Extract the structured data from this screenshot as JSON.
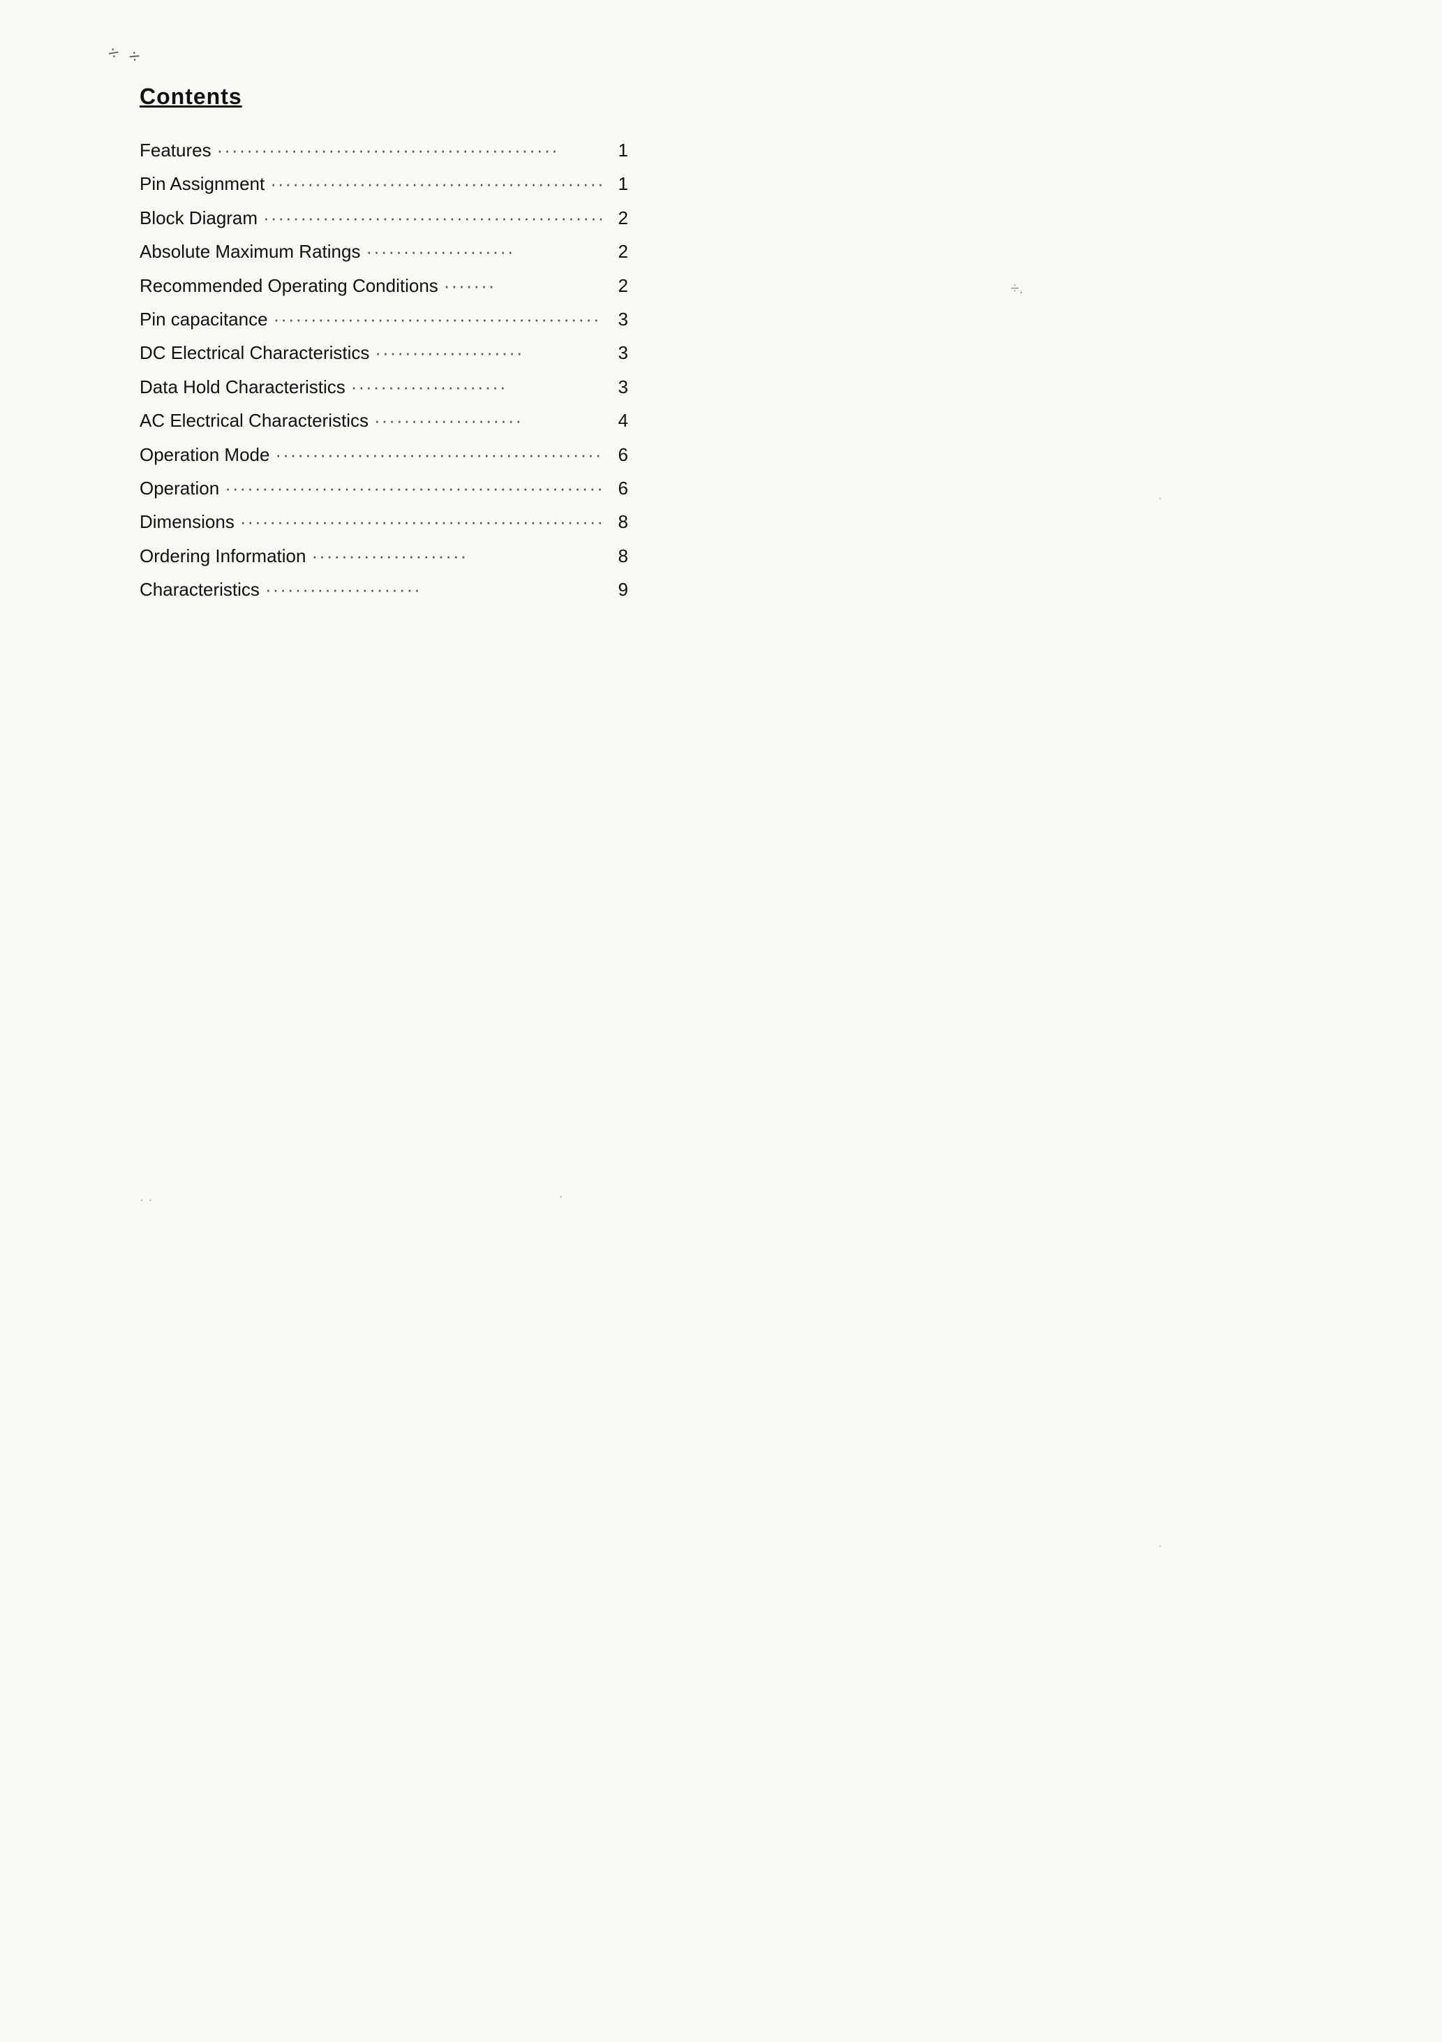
{
  "page": {
    "title": "Contents",
    "toc": {
      "items": [
        {
          "label": "Features",
          "dots": "·······························································",
          "page": "1"
        },
        {
          "label": "Pin Assignment",
          "dots": "·······························································",
          "page": "1"
        },
        {
          "label": "Block Diagram",
          "dots": "·······························································",
          "page": "2"
        },
        {
          "label": "Absolute Maximum Ratings",
          "dots": "·················",
          "page": "2"
        },
        {
          "label": "Recommended Operating Conditions",
          "dots": "········",
          "page": "2"
        },
        {
          "label": "Pin capacitance",
          "dots": "·······························································",
          "page": "3"
        },
        {
          "label": "DC Electrical Characteristics",
          "dots": "···················",
          "page": "3"
        },
        {
          "label": "Data Hold Characteristics",
          "dots": "·····················",
          "page": "3"
        },
        {
          "label": "AC Electrical Characteristics",
          "dots": "···················",
          "page": "4"
        },
        {
          "label": "Operation Mode",
          "dots": "·······························································",
          "page": "6"
        },
        {
          "label": "Operation",
          "dots": "·······························································",
          "page": "6"
        },
        {
          "label": "Dimensions",
          "dots": "·······························································",
          "page": "8"
        },
        {
          "label": "Ordering Information",
          "dots": "·······················",
          "page": "8"
        },
        {
          "label": "Characteristics",
          "dots": "·······················",
          "page": "9"
        }
      ]
    }
  }
}
